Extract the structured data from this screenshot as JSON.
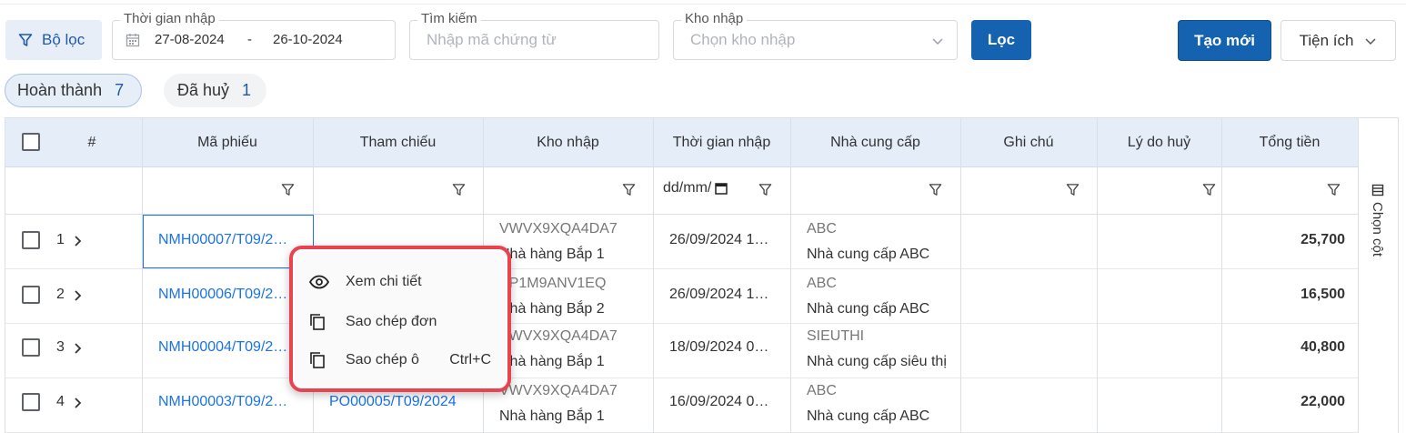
{
  "toolbar": {
    "filter_button": "Bộ lọc",
    "date_label": "Thời gian nhập",
    "date_from": "27-08-2024",
    "date_sep": "-",
    "date_to": "26-10-2024",
    "search_label": "Tìm kiếm",
    "search_placeholder": "Nhập mã chứng từ",
    "store_label": "Kho nhập",
    "store_placeholder": "Chọn kho nhập",
    "apply_button": "Lọc",
    "create_button": "Tạo mới",
    "utilities_button": "Tiện ích"
  },
  "tabs": [
    {
      "label": "Hoàn thành",
      "count": "7"
    },
    {
      "label": "Đã huỷ",
      "count": "1"
    }
  ],
  "table": {
    "headers": {
      "index": "#",
      "code": "Mã phiếu",
      "reference": "Tham chiếu",
      "store": "Kho nhập",
      "time": "Thời gian nhập",
      "supplier": "Nhà cung cấp",
      "note": "Ghi chú",
      "cancel_reason": "Lý do huỷ",
      "total": "Tổng tiền"
    },
    "date_filter_placeholder": "dd/mm/",
    "column_chooser": "Chọn cột",
    "rows": [
      {
        "num": "1",
        "code": "NMH00007/T09/2…",
        "reference": "",
        "store_code": "VWVX9XQA4DA7",
        "store_name": "Nhà hàng Bắp 1",
        "time": "26/09/2024 1…",
        "supplier_code": "ABC",
        "supplier_name": "Nhà cung cấp ABC",
        "total": "25,700"
      },
      {
        "num": "2",
        "code": "NMH00006/T09/2…",
        "reference": "",
        "store_code": "EP1M9ANV1EQ",
        "store_name": "Nhà hàng Bắp 2",
        "time": "26/09/2024 1…",
        "supplier_code": "ABC",
        "supplier_name": "Nhà cung cấp ABC",
        "total": "16,500"
      },
      {
        "num": "3",
        "code": "NMH00004/T09/2…",
        "reference": "",
        "store_code": "VWVX9XQA4DA7",
        "store_name": "Nhà hàng Bắp 1",
        "time": "18/09/2024 0…",
        "supplier_code": "SIEUTHI",
        "supplier_name": "Nhà cung cấp siêu thị",
        "total": "40,800"
      },
      {
        "num": "4",
        "code": "NMH00003/T09/2…",
        "reference": "PO00005/T09/2024",
        "store_code": "VWVX9XQA4DA7",
        "store_name": "Nhà hàng Bắp 1",
        "time": "16/09/2024 0…",
        "supplier_code": "ABC",
        "supplier_name": "Nhà cung cấp ABC",
        "total": "22,000"
      }
    ]
  },
  "context_menu": {
    "view": "Xem chi tiết",
    "copy_order": "Sao chép đơn",
    "copy_cell": "Sao chép ô",
    "copy_cell_shortcut": "Ctrl+C"
  },
  "colors": {
    "primary": "#1462b0",
    "link": "#1a73e8",
    "header_bg": "#e4edf8",
    "highlight": "#e8434f"
  }
}
